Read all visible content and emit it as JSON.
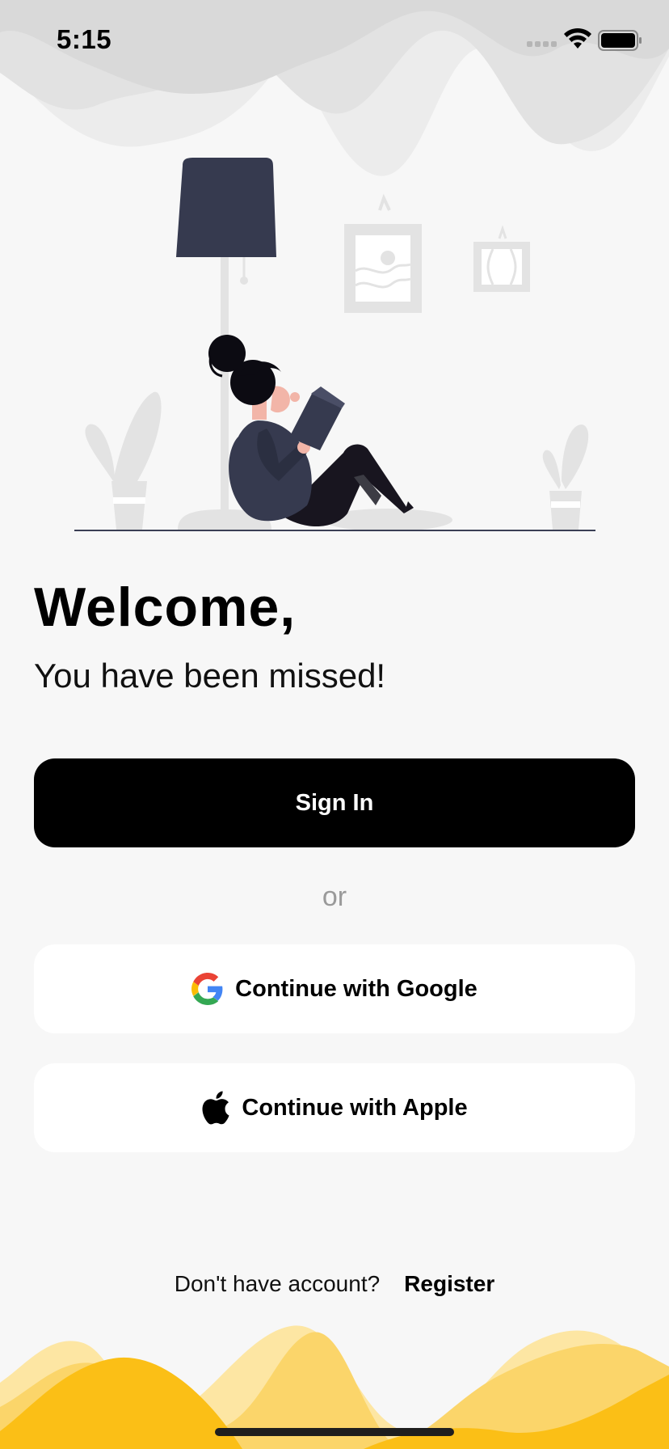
{
  "status_bar": {
    "time": "5:15"
  },
  "welcome": {
    "title": "Welcome,",
    "subtitle": "You have been missed!"
  },
  "actions": {
    "sign_in_label": "Sign In",
    "divider_text": "or",
    "google_label": "Continue with Google",
    "apple_label": "Continue with Apple"
  },
  "footer": {
    "prompt": "Don't have account?",
    "register_label": "Register"
  },
  "icons": {
    "google": "google-logo-icon",
    "apple": "apple-logo-icon",
    "wifi": "wifi-icon",
    "battery": "battery-icon"
  },
  "colors": {
    "accent_yellow": "#fbbf16",
    "primary_button": "#000000",
    "background": "#f7f7f7"
  }
}
